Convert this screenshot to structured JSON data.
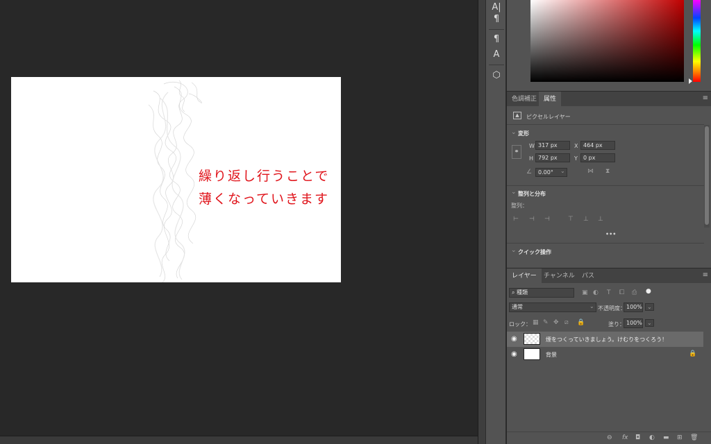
{
  "canvas": {
    "lines": [
      "繰り返し行うことで",
      "薄くなっていきます"
    ]
  },
  "toolstrip": {
    "icons": [
      "text-tool-icon",
      "paragraph-icon",
      "character-style-icon",
      "paragraph-style-icon",
      "3d-cube-icon"
    ],
    "glyphs": [
      "A|",
      "¶",
      "¶",
      "A",
      "⬡"
    ]
  },
  "colors": {
    "accent_text": "#e0141b"
  },
  "adjust_tabs": [
    {
      "label": "色調補正",
      "active": false
    },
    {
      "label": "属性",
      "active": true
    }
  ],
  "properties": {
    "layer_type": "ピクセルレイヤー",
    "transform": {
      "title": "変形",
      "w_label": "W",
      "w": "317 px",
      "h_label": "H",
      "h": "792 px",
      "x_label": "X",
      "x": "464 px",
      "y_label": "Y",
      "y": "0 px",
      "angle": "0.00°"
    },
    "align": {
      "title": "整列と分布",
      "label": "整列："
    },
    "more": "•••",
    "quick": {
      "title": "クイック操作"
    }
  },
  "layer_tabs": [
    {
      "label": "レイヤー",
      "active": true
    },
    {
      "label": "チャンネル",
      "active": false
    },
    {
      "label": "パス",
      "active": false
    }
  ],
  "layers_panel": {
    "filter": "種類",
    "blend_mode": "通常",
    "opacity_label": "不透明度：",
    "opacity": "100%",
    "lock_label": "ロック：",
    "fill_label": "塗り：",
    "fill": "100%",
    "layers": [
      {
        "name": "煙をつくっていきましょう。けむりをつくろう！",
        "selected": true,
        "transparent": true,
        "locked": false
      },
      {
        "name": "背景",
        "selected": false,
        "transparent": false,
        "locked": true
      }
    ],
    "footer_icons": [
      "link-icon",
      "fx-icon",
      "mask-icon",
      "adjustment-icon",
      "folder-icon",
      "new-layer-icon",
      "trash-icon"
    ],
    "footer_glyphs": [
      "⊖",
      "fx",
      "◘",
      "◐",
      "▬",
      "⊞",
      "🗑"
    ]
  }
}
